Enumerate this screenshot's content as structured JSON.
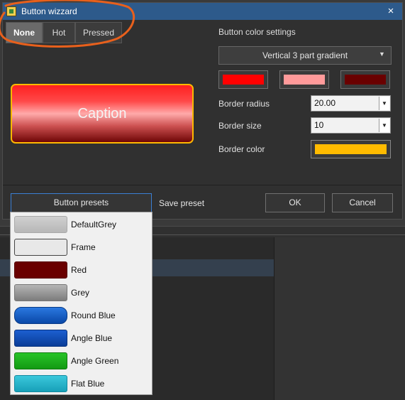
{
  "window": {
    "title": "Button wizzard",
    "close_icon": "×"
  },
  "state_tabs": [
    {
      "label": "None",
      "selected": true
    },
    {
      "label": "Hot",
      "selected": false
    },
    {
      "label": "Pressed",
      "selected": false
    }
  ],
  "preview": {
    "caption": "Caption"
  },
  "color_settings": {
    "title": "Button color settings",
    "gradient_mode": "Vertical 3 part gradient",
    "colors": [
      "#ff0000",
      "#ff9a9a",
      "#6a0000"
    ]
  },
  "border": {
    "radius_label": "Border radius",
    "radius_value": "20.00",
    "size_label": "Border size",
    "size_value": "10",
    "color_label": "Border color",
    "color": "#ffbb00"
  },
  "footer": {
    "presets_label": "Button presets",
    "save_label": "Save preset",
    "ok_label": "OK",
    "cancel_label": "Cancel"
  },
  "presets": [
    {
      "label": "DefaultGrey"
    },
    {
      "label": "Frame"
    },
    {
      "label": "Red"
    },
    {
      "label": "Grey"
    },
    {
      "label": "Round Blue"
    },
    {
      "label": "Angle Blue"
    },
    {
      "label": "Angle Green"
    },
    {
      "label": "Flat Blue"
    }
  ]
}
